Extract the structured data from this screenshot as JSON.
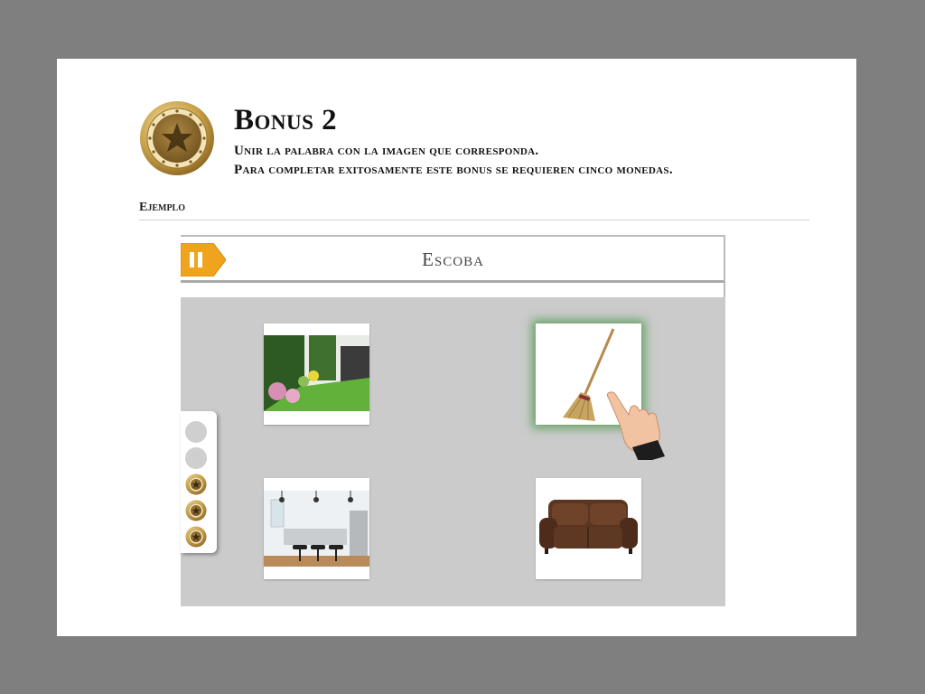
{
  "header": {
    "title": "Bonus 2",
    "instruction_line1": "Unir la palabra con la imagen que corresponda.",
    "instruction_line2": "Para completar exitosamente este bonus se requieren cinco monedas."
  },
  "example_label": "Ejemplo",
  "app": {
    "word": "Escoba",
    "cards": [
      {
        "name": "garden",
        "selected": false
      },
      {
        "name": "broom",
        "selected": true
      },
      {
        "name": "kitchen",
        "selected": false
      },
      {
        "name": "sofa",
        "selected": false
      }
    ],
    "coins": {
      "empty": 2,
      "earned": 3
    },
    "icons": [
      "coin-logo-icon",
      "pause-icon",
      "pointing-hand-icon",
      "coin-icon"
    ],
    "colors": {
      "accent_orange": "#f0a41e",
      "selection_glow": "#5aa55a",
      "gold": "#c9a24a",
      "play_area": "#cbcbcb"
    }
  }
}
